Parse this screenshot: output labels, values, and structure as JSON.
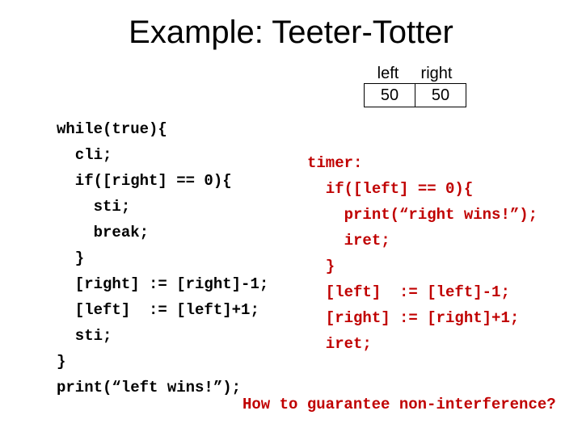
{
  "title": "Example: Teeter-Totter",
  "registers": {
    "left_label": "left",
    "right_label": "right",
    "left_value": "50",
    "right_value": "50"
  },
  "left_code": {
    "l0": "while(true){",
    "l1": "  cli;",
    "l2": "  if([right] == 0){",
    "l3": "    sti;",
    "l4": "    break;",
    "l5": "  }",
    "l6": "  [right] := [right]-1;",
    "l7": "  [left]  := [left]+1;",
    "l8": "  sti;",
    "l9": "}",
    "l10": "print(“left wins!”);"
  },
  "right_code": {
    "l0": "timer:",
    "l1": "  if([left] == 0){",
    "l2": "    print(“right wins!”);",
    "l3": "    iret;",
    "l4": "  }",
    "l5": "  [left]  := [left]-1;",
    "l6": "  [right] := [right]+1;",
    "l7": "  iret;"
  },
  "question": "How to guarantee non-interference?"
}
